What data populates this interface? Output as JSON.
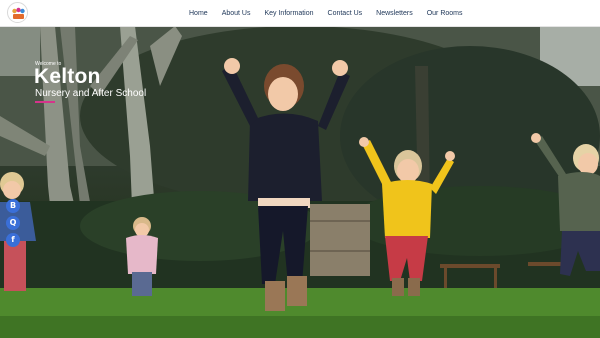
{
  "logo": {
    "icon": "school-logo-icon"
  },
  "nav": {
    "items": [
      {
        "label": "Home"
      },
      {
        "label": "About Us"
      },
      {
        "label": "Key Information"
      },
      {
        "label": "Contact Us"
      },
      {
        "label": "Newsletters"
      },
      {
        "label": "Our Rooms"
      }
    ]
  },
  "hero": {
    "welcome": "Welcome to",
    "title": "Kelton",
    "subtitle": "Nursery and After School",
    "accent_color": "#d6338b"
  },
  "social": {
    "items": [
      {
        "icon": "blog-icon",
        "glyph": "B"
      },
      {
        "icon": "search-icon",
        "glyph": "Q"
      },
      {
        "icon": "facebook-icon",
        "glyph": "f"
      }
    ],
    "color": "#3a6fd8"
  }
}
